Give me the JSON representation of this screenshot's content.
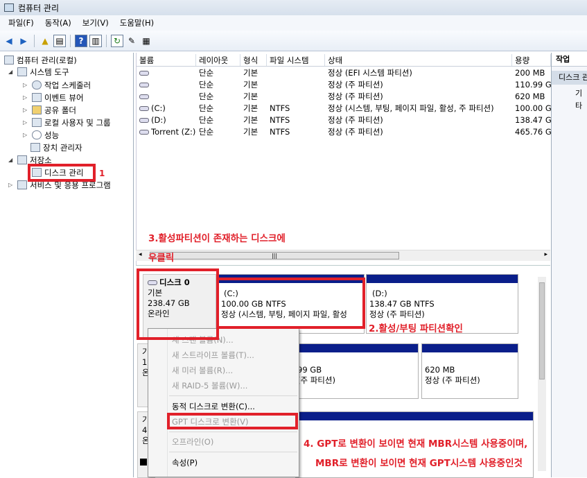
{
  "window": {
    "title": "컴퓨터 관리"
  },
  "menu": [
    "파일(F)",
    "동작(A)",
    "보기(V)",
    "도움말(H)"
  ],
  "tree": {
    "root": "컴퓨터 관리(로컬)",
    "system_tools": "시스템 도구",
    "task_scheduler": "작업 스케줄러",
    "event_viewer": "이벤트 뷰어",
    "shared_folders": "공유 폴더",
    "local_users": "로컬 사용자 및 그룹",
    "performance": "성능",
    "device_manager": "장치 관리자",
    "storage": "저장소",
    "disk_management": "디스크 관리",
    "services": "서비스 및 응용 프로그램"
  },
  "volume_table": {
    "headers": [
      "볼륨",
      "레이아웃",
      "형식",
      "파일 시스템",
      "상태",
      "용량"
    ],
    "rows": [
      [
        "",
        "단순",
        "기본",
        "",
        "정상 (EFI 시스템 파티션)",
        "200 MB"
      ],
      [
        "",
        "단순",
        "기본",
        "",
        "정상 (주 파티션)",
        "110.99 G"
      ],
      [
        "",
        "단순",
        "기본",
        "",
        "정상 (주 파티션)",
        "620 MB"
      ],
      [
        "(C:)",
        "단순",
        "기본",
        "NTFS",
        "정상 (시스템, 부팅, 페이지 파일, 활성, 주 파티션)",
        "100.00 G"
      ],
      [
        "(D:)",
        "단순",
        "기본",
        "NTFS",
        "정상 (주 파티션)",
        "138.47 G"
      ],
      [
        "Torrent (Z:)",
        "단순",
        "기본",
        "NTFS",
        "정상 (주 파티션)",
        "465.76 G"
      ]
    ]
  },
  "action_pane": {
    "header": "작업",
    "item": "디스크 관",
    "sub": "기타"
  },
  "disk0": {
    "name": "디스크 0",
    "type": "기본",
    "size": "238.47 GB",
    "status": "온라인"
  },
  "disk1": {
    "l1": "기",
    "l2": "1",
    "l3": "온"
  },
  "disk2": {
    "l1": "기",
    "l2": "4",
    "l3": "온"
  },
  "partitions": {
    "c": {
      "name": "(C:)",
      "size": "100.00 GB NTFS",
      "status": "정상 (시스템, 부팅, 페이지 파일, 활성"
    },
    "d": {
      "name": "(D:)",
      "size": "138.47 GB NTFS",
      "status": "정상 (주 파티션)"
    },
    "p2": {
      "size": "99 GB",
      "status": "(주 파티션)"
    },
    "p3": {
      "size": "620 MB",
      "status": "정상 (주 파티션)"
    }
  },
  "context_menu": [
    {
      "label": "새 스팬 볼륨(N)...",
      "enabled": false
    },
    {
      "label": "새 스트라이프 볼륨(T)...",
      "enabled": false
    },
    {
      "label": "새 미러 볼륨(R)...",
      "enabled": false
    },
    {
      "label": "새 RAID-5 볼륨(W)...",
      "enabled": false
    },
    {
      "label": "동적 디스크로 변환(C)...",
      "enabled": true
    },
    {
      "label": "GPT 디스크로 변환(V)",
      "enabled": false
    },
    {
      "label": "오프라인(O)",
      "enabled": false
    },
    {
      "label": "속성(P)",
      "enabled": true
    }
  ],
  "annotations": {
    "a1": "1",
    "a2": "2.활성/부팅 파티션확인",
    "a3_line1": "3.활성파티션이 존재하는 디스크에",
    "a3_line2": "우클릭",
    "a4_line1": "4. GPT로 변환이 보이면 현재 MBR시스템 사용중이며,",
    "a4_line2": "MBR로 변환이 보이면 현재 GPT시스템 사용중인것"
  },
  "colors": {
    "annotation": "#e1202a",
    "partition_bar": "#0a1e8a"
  }
}
